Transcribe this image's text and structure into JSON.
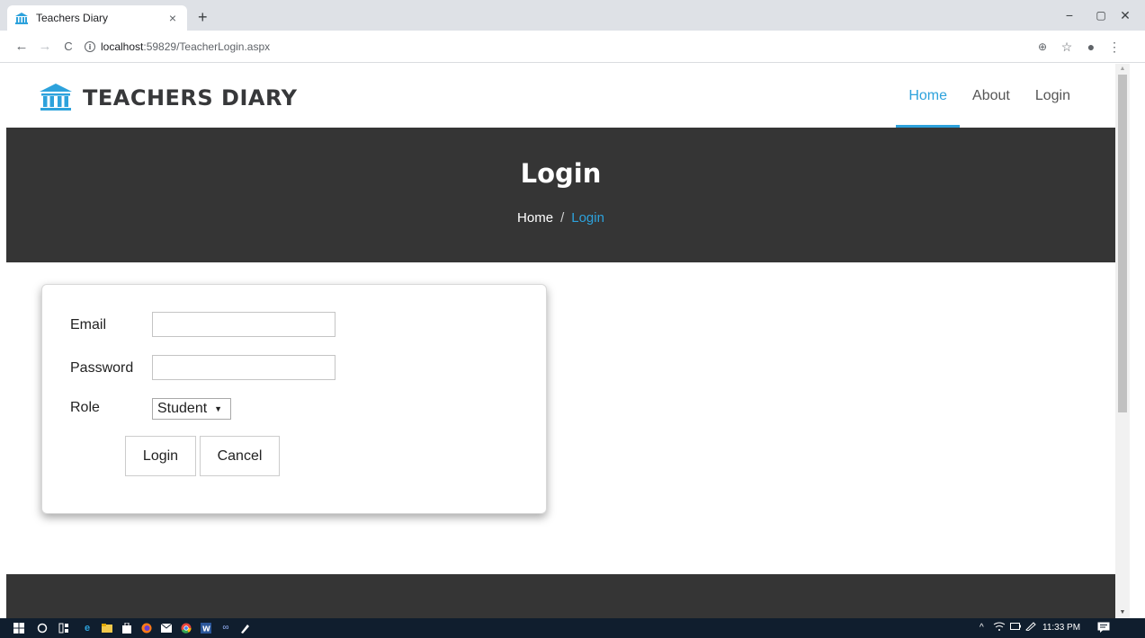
{
  "browser": {
    "tab_title": "Teachers Diary",
    "tab_close": "×",
    "new_tab": "+",
    "url_host": "localhost",
    "url_path": ":59829/TeacherLogin.aspx",
    "window_controls": {
      "minimize": "−",
      "maximize": "▢",
      "close": "✕"
    },
    "nav": {
      "back": "←",
      "forward": "→",
      "reload": "C"
    },
    "toolbar_icons": {
      "zoom": "⊕",
      "star": "☆",
      "account": "●",
      "menu": "⋮"
    }
  },
  "site": {
    "brand": "TEACHERS DIARY",
    "brand_color": "#2da2dc",
    "nav": [
      {
        "label": "Home",
        "active": true
      },
      {
        "label": "About",
        "active": false
      },
      {
        "label": "Login",
        "active": false
      }
    ]
  },
  "hero": {
    "title": "Login",
    "breadcrumb_home": "Home",
    "breadcrumb_sep": "/",
    "breadcrumb_current": "Login"
  },
  "form": {
    "email_label": "Email",
    "email_value": "",
    "password_label": "Password",
    "password_value": "",
    "role_label": "Role",
    "role_selected": "Student",
    "role_caret": "▼",
    "login_button": "Login",
    "cancel_button": "Cancel"
  },
  "scrollbar": {
    "up": "▲",
    "down": "▼"
  },
  "taskbar": {
    "start_icon": "windows-icon",
    "search_icon": "O",
    "taskview_icon": "task-view-icon",
    "clock": "11:33 PM"
  }
}
